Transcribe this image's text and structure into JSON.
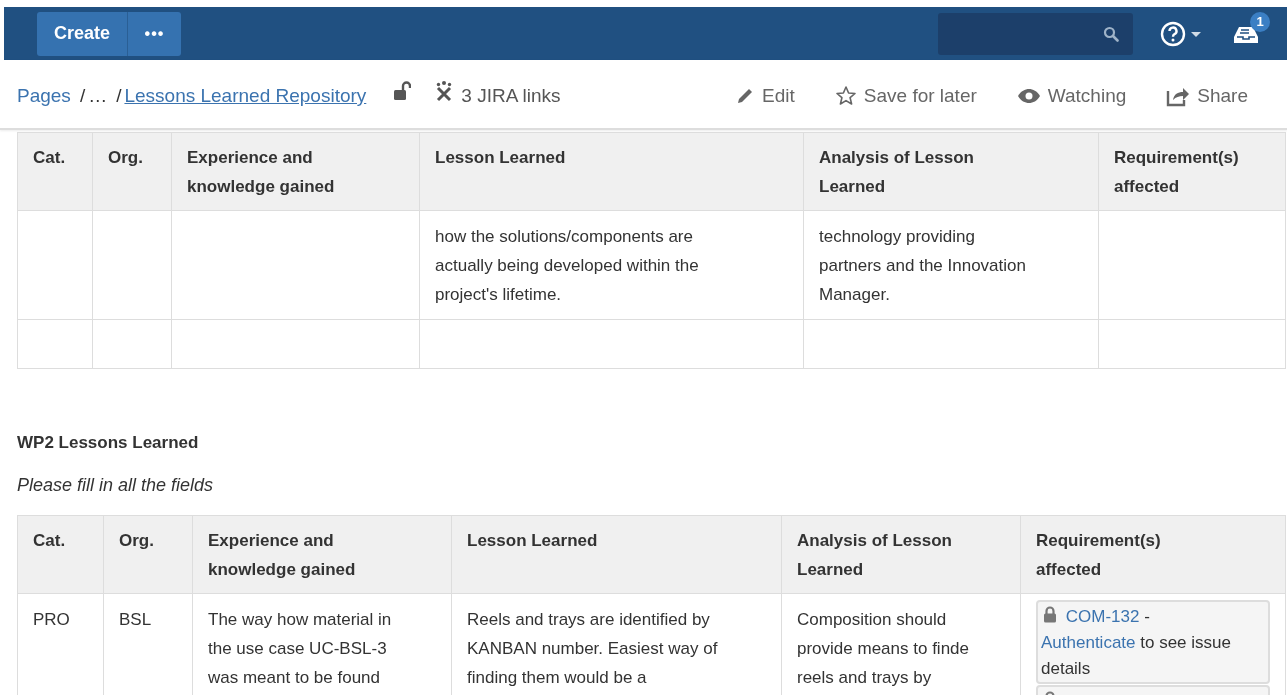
{
  "top_bar": {
    "create_button": "Create",
    "more_button": "•••",
    "notifications": {
      "count": "1"
    }
  },
  "breadcrumbs": [
    {
      "kind": "link",
      "label": "Pages"
    },
    {
      "kind": "separator",
      "label": "/"
    },
    {
      "kind": "text",
      "label": "…"
    },
    {
      "kind": "separator",
      "label": "/"
    },
    {
      "kind": "link",
      "label": "Lessons Learned Repository"
    }
  ],
  "page_meta": [
    {
      "kind": "restrictions"
    },
    {
      "kind": "jira",
      "label": "3 JIRA links"
    }
  ],
  "page_actions": [
    {
      "kind": "edit",
      "label": "Edit"
    },
    {
      "kind": "save",
      "label": "Save for later"
    },
    {
      "kind": "watch",
      "label": "Watching"
    },
    {
      "kind": "share",
      "label": "Share"
    }
  ],
  "sections": [
    {
      "kind": "table",
      "columns": [
        "Cat.",
        "Org.",
        "Experience and\nknowledge gained",
        "Lesson Learned",
        "Analysis of Lesson\nLearned",
        "Requirement(s)\naffected"
      ],
      "rows": [
        {
          "cells": [
            null,
            null,
            null,
            {
              "text": "how the solutions/components are\nactually being developed within the\nproject's lifetime."
            },
            {
              "text": "technology providing\npartners and the Innovation\nManager."
            },
            null
          ]
        },
        {
          "cells": [
            null,
            null,
            null,
            null,
            null,
            null
          ]
        }
      ]
    },
    {
      "kind": "heading",
      "text": "WP2 Lessons Learned"
    },
    {
      "kind": "instruction",
      "text": "Please fill in all the fields"
    },
    {
      "kind": "table",
      "columns": [
        "Cat.",
        "Org.",
        "Experience and\nknowledge gained",
        "Lesson Learned",
        "Analysis of Lesson\nLearned",
        "Requirement(s)\naffected"
      ],
      "rows": [
        {
          "cells": [
            {
              "text": "PRO"
            },
            {
              "text": "BSL"
            },
            {
              "text": "The way how material in\nthe use case UC-BSL-3\nwas meant to be found"
            },
            {
              "text": "Reels and trays are identified by\nKANBAN number. Easiest way of\nfinding them would be a"
            },
            {
              "text": "Composition should\nprovide means to finde\nreels and trays by"
            },
            {
              "kind": "issues",
              "issues": [
                {
                  "locked": true,
                  "key": "COM-132",
                  "separator": "-",
                  "auth_link": "Authenticate",
                  "note": "to see issue details"
                },
                {
                  "locked": true
                }
              ]
            }
          ]
        }
      ]
    }
  ]
}
